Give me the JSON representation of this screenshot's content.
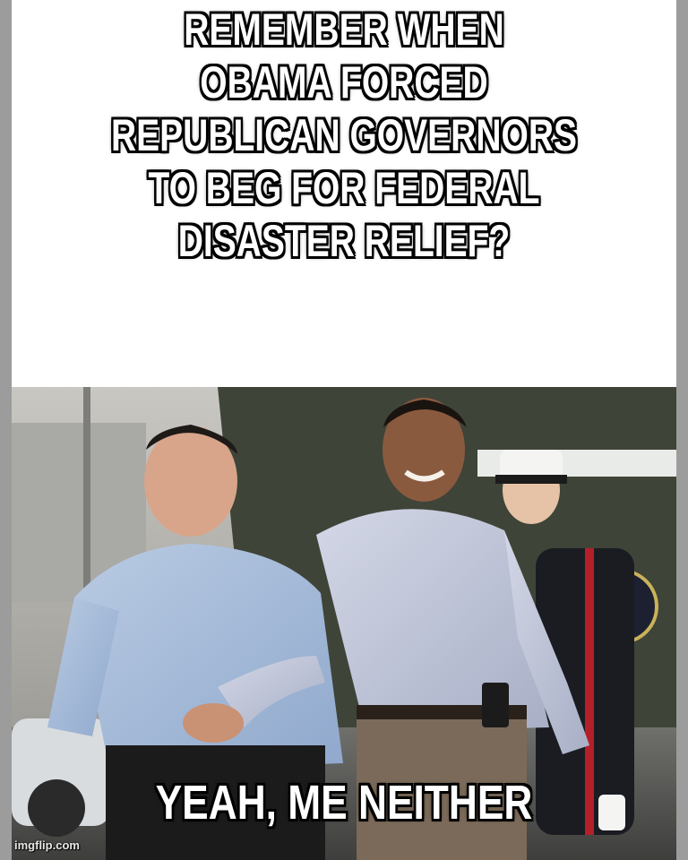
{
  "meme": {
    "top_text": "REMEMBER WHEN\nOBAMA FORCED\nREPUBLICAN GOVERNORS\nTO BEG FOR FEDERAL\nDISASTER RELIEF?",
    "bottom_text": "YEAH, ME NEITHER",
    "watermark": "imgflip.com"
  },
  "colors": {
    "caption_fill": "#ffffff",
    "caption_outline": "#000000",
    "panel_background": "#ffffff"
  }
}
